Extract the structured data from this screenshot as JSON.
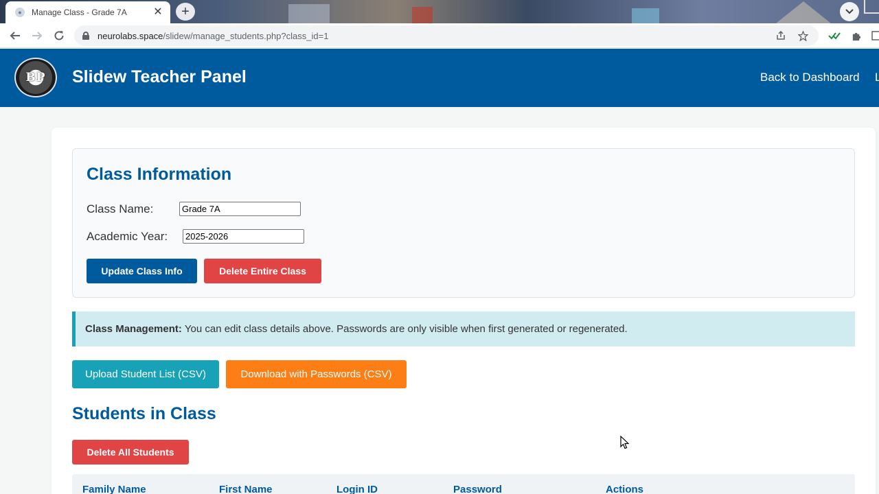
{
  "browser": {
    "tab_title": "Manage Class - Grade 7A",
    "tab_close": "✕",
    "new_tab": "+",
    "tab_menu": "⌄",
    "url_host": "neurolabs.space",
    "url_path": "/slidew/manage_students.php?class_id=1",
    "icons": [
      "back-icon",
      "forward-icon",
      "reload-icon",
      "lock-icon",
      "share-icon",
      "star-icon",
      "check-extension-icon",
      "puzzle-icon",
      "side-panel-icon"
    ]
  },
  "header": {
    "logo_text": "BP",
    "title": "Slidew Teacher Panel",
    "nav": {
      "dashboard": "Back to Dashboard",
      "logout": "L"
    }
  },
  "class_info": {
    "title": "Class Information",
    "name_label": "Class Name:",
    "name_value": "Grade 7A",
    "year_label": "Academic Year:",
    "year_value": "2025-2026",
    "update_button": "Update Class Info",
    "delete_button": "Delete Entire Class"
  },
  "alert": {
    "strong": "Class Management:",
    "text": "You can edit class details above. Passwords are only visible when first generated or regenerated."
  },
  "actions": {
    "upload_button": "Upload Student List (CSV)",
    "download_button": "Download with Passwords (CSV)"
  },
  "students": {
    "title": "Students in Class",
    "delete_all_button": "Delete All Students",
    "columns": [
      "Family Name",
      "First Name",
      "Login ID",
      "Password",
      "Actions"
    ]
  },
  "colors": {
    "primary": "#005a9e",
    "danger": "#e04444",
    "info": "#17a2b8",
    "warning": "#fd7e14",
    "alert_bg": "#d1ecf1"
  }
}
